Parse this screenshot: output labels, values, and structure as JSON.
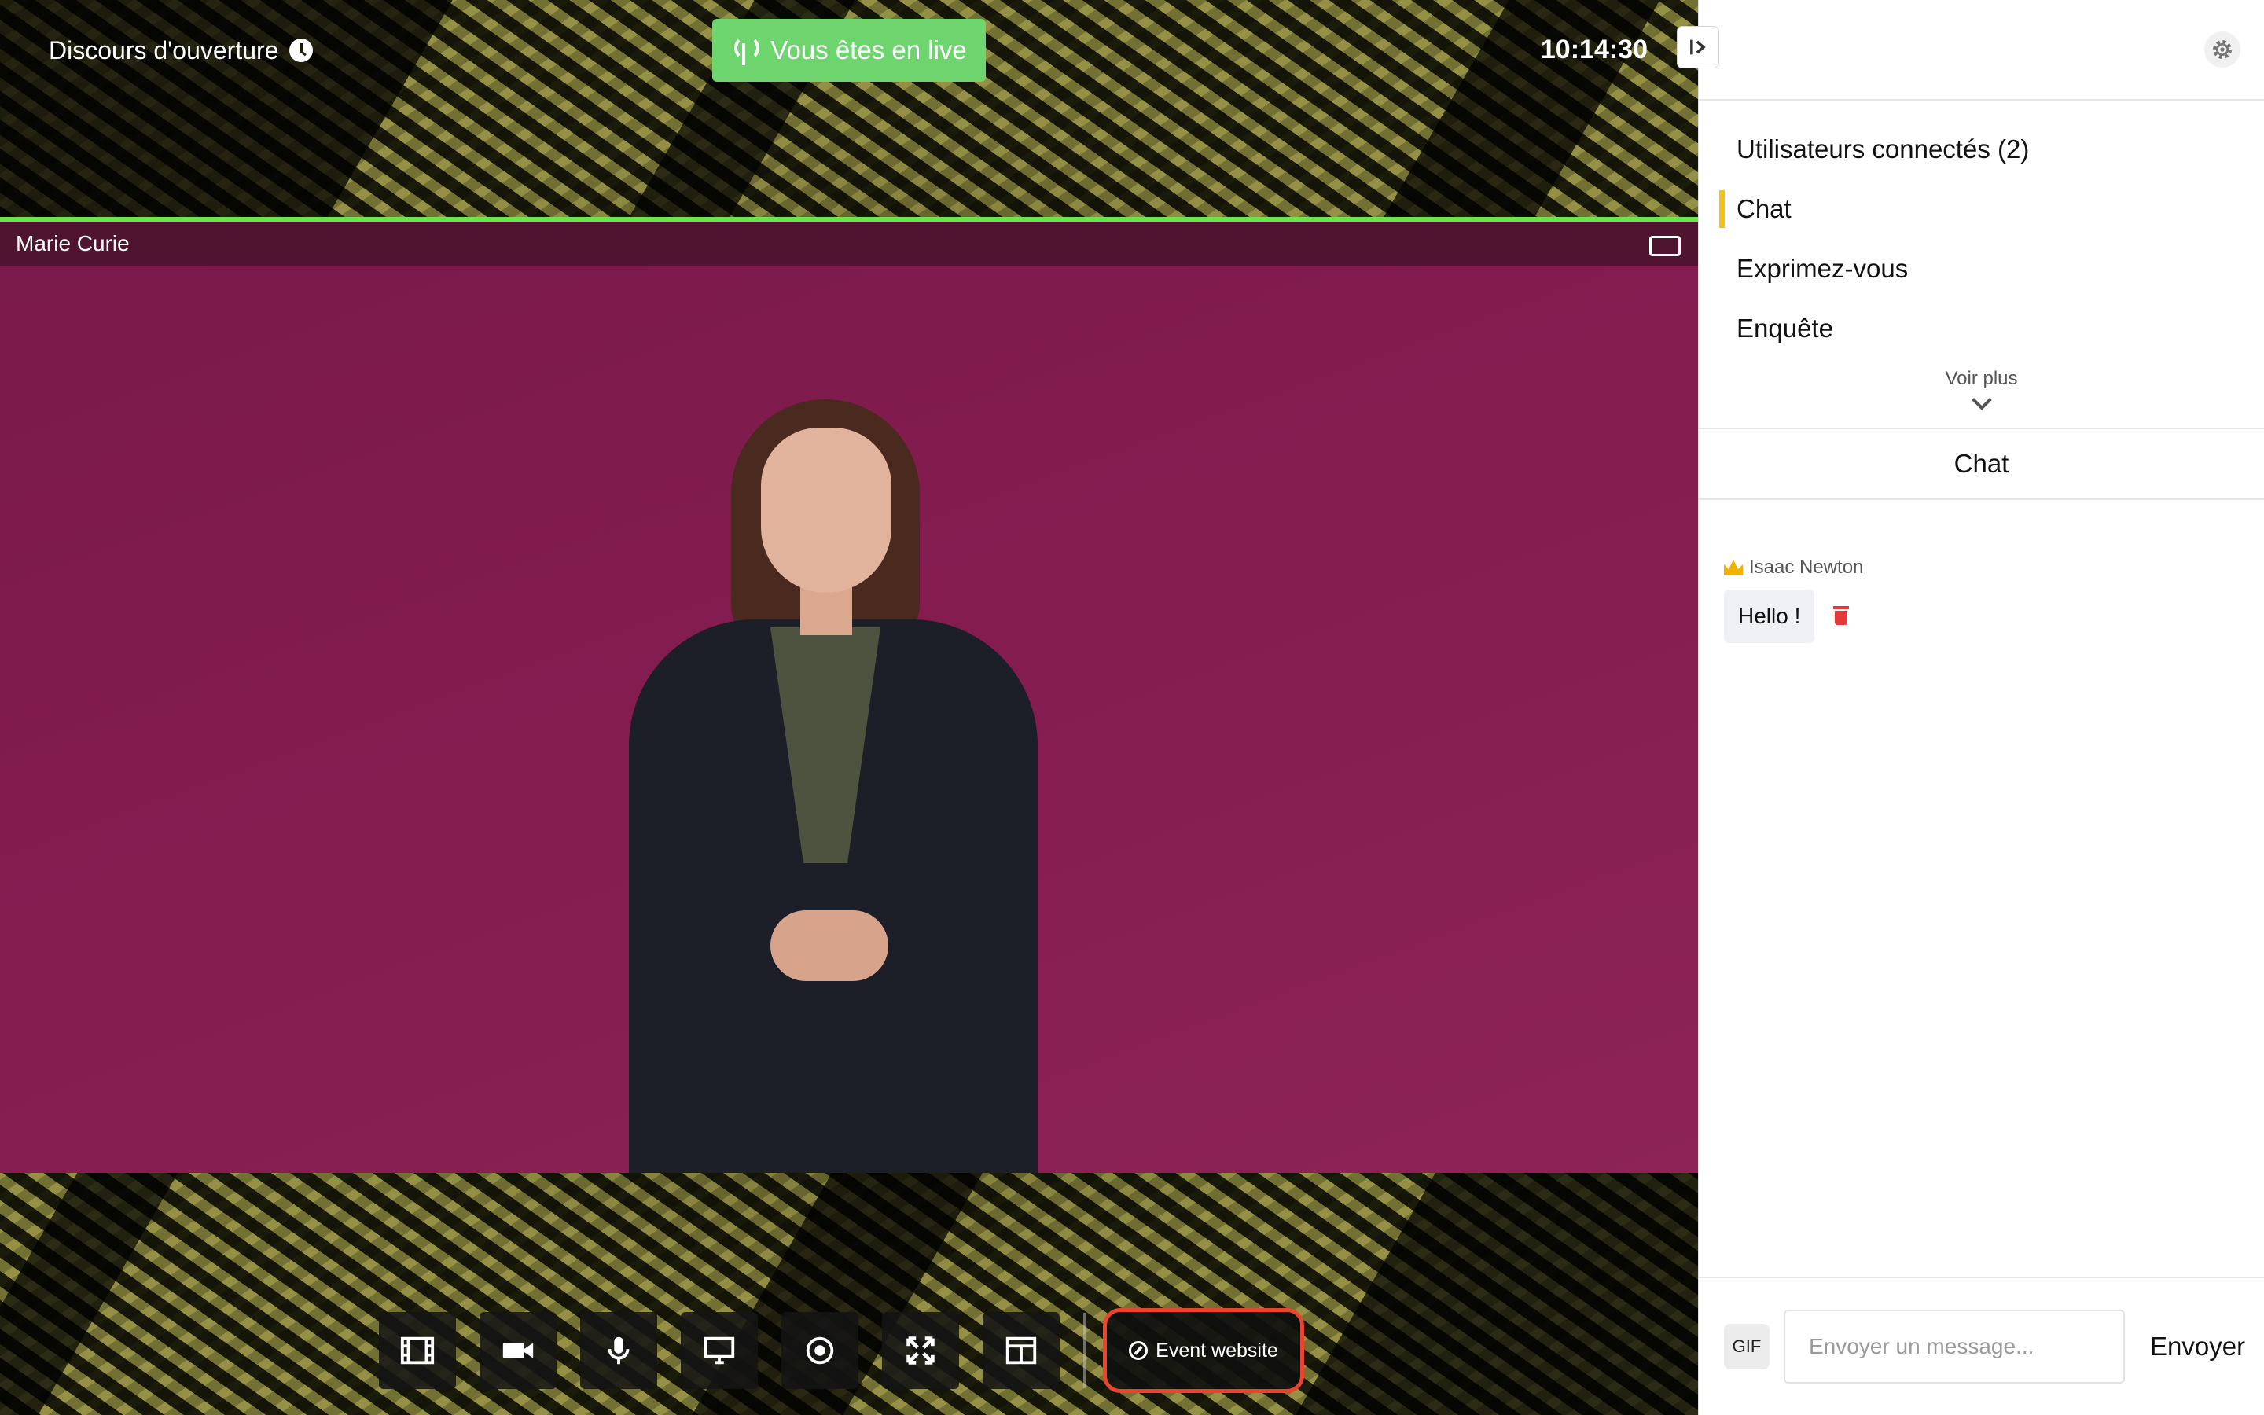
{
  "stage": {
    "session_title": "Discours d'ouverture",
    "live_badge": "Vous êtes en live",
    "timer": "10:14:30",
    "speaker_name": "Marie Curie",
    "controls": [
      {
        "name": "media-library-button",
        "icon": "film-icon"
      },
      {
        "name": "camera-button",
        "icon": "video-camera-icon"
      },
      {
        "name": "microphone-button",
        "icon": "microphone-icon"
      },
      {
        "name": "screen-share-button",
        "icon": "monitor-icon"
      },
      {
        "name": "record-button",
        "icon": "record-icon"
      },
      {
        "name": "fullscreen-button",
        "icon": "expand-icon"
      },
      {
        "name": "layout-button",
        "icon": "layout-columns-icon"
      }
    ],
    "event_website_label": "Event website"
  },
  "sidebar": {
    "menu": [
      {
        "label": "Utilisateurs connectés (2)",
        "active": false
      },
      {
        "label": "Chat",
        "active": true
      },
      {
        "label": "Exprimez-vous",
        "active": false
      },
      {
        "label": "Enquête",
        "active": false
      }
    ],
    "see_more": "Voir plus",
    "panel_title": "Chat",
    "messages": [
      {
        "author": "Isaac Newton",
        "text": "Hello !"
      }
    ],
    "composer": {
      "gif_label": "GIF",
      "placeholder": "Envoyer un message...",
      "send_label": "Envoyer"
    }
  },
  "colors": {
    "live_green": "#6dd46e",
    "video_background": "#841c50",
    "active_accent": "#f2c21b",
    "highlight_border": "#e8452c",
    "delete_red": "#e03a3a"
  }
}
